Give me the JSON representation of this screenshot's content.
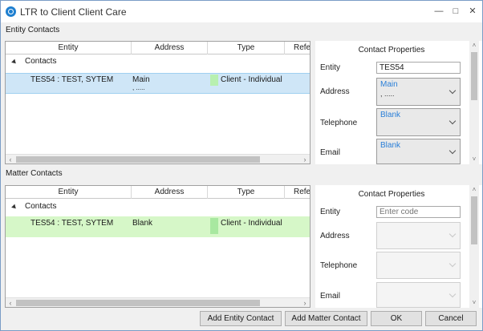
{
  "window": {
    "title": "LTR to Client Client Care"
  },
  "entity_section": {
    "label": "Entity Contacts",
    "columns": [
      "Entity",
      "Address",
      "Type",
      "Refe"
    ],
    "group": "Contacts",
    "row": {
      "entity": "TES54 : TEST, SYTEM",
      "address": "Main",
      "address_sub": ", .....",
      "type": "Client - Individual"
    },
    "props": {
      "title": "Contact Properties",
      "entity_label": "Entity",
      "entity_value": "TES54",
      "address_label": "Address",
      "address_value": "Main",
      "address_sub": ", .....",
      "telephone_label": "Telephone",
      "telephone_value": "Blank",
      "email_label": "Email",
      "email_value": "Blank"
    }
  },
  "matter_section": {
    "label": "Matter Contacts",
    "columns": [
      "Entity",
      "Address",
      "Type",
      "Refe"
    ],
    "group": "Contacts",
    "row": {
      "entity": "TES54 : TEST, SYTEM",
      "address": "Blank",
      "type": "Client - Individual"
    },
    "props": {
      "title": "Contact Properties",
      "entity_label": "Entity",
      "entity_placeholder": "Enter code",
      "address_label": "Address",
      "telephone_label": "Telephone",
      "email_label": "Email"
    }
  },
  "buttons": {
    "add_entity": "Add Entity Contact",
    "add_matter": "Add Matter Contact",
    "ok": "OK",
    "cancel": "Cancel"
  },
  "colors": {
    "selected_row": "#cfe6f7",
    "green_row": "#d6f7c8",
    "link_blue": "#2a7fd8"
  }
}
